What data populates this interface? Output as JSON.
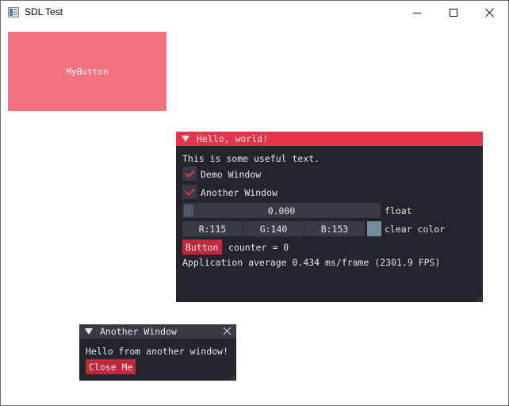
{
  "window": {
    "title": "SDL Test",
    "icon": "app-window-icon"
  },
  "my_button": {
    "label": "MyButton",
    "color": "#f2727f"
  },
  "hello_window": {
    "title": "Hello, world!",
    "title_color": "#e3344a",
    "text": "This is some useful text.",
    "checkboxes": [
      {
        "label": "Demo Window",
        "checked": true
      },
      {
        "label": "Another Window",
        "checked": true
      }
    ],
    "slider": {
      "value": "0.000",
      "label": "float",
      "fraction": 0.0
    },
    "color_edit": {
      "r": "R:115",
      "g": "G:140",
      "b": "B:153",
      "label": "clear color",
      "swatch": "#738c99"
    },
    "button_label": "Button",
    "counter_text": "counter = 0",
    "stats": "Application average 0.434 ms/frame (2301.9 FPS)"
  },
  "another_window": {
    "title": "Another Window",
    "text": "Hello from another window!",
    "close_button": "Close Me"
  }
}
